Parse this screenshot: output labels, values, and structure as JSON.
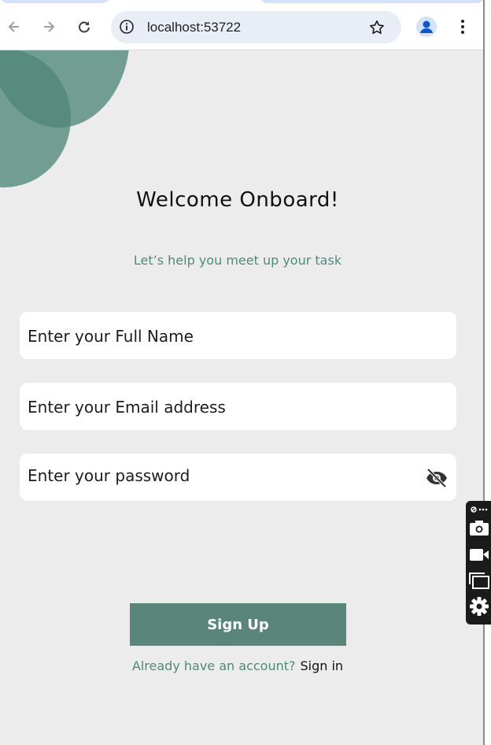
{
  "browser": {
    "back_icon": "arrow-left-icon",
    "forward_icon": "arrow-right-icon",
    "reload_icon": "reload-icon",
    "url": "localhost:53722",
    "info_icon": "info-icon",
    "bookmark_icon": "star-icon",
    "profile_icon": "person-icon",
    "menu_icon": "kebab-icon"
  },
  "page": {
    "title": "Welcome Onboard!",
    "subtitle": "Let’s help you meet up your task",
    "fields": {
      "full_name_placeholder": "Enter your Full Name",
      "email_placeholder": "Enter your Email address",
      "password_placeholder": "Enter your password",
      "password_toggle_icon": "eye-slash-icon"
    },
    "signup_button": "Sign Up",
    "signin_prompt": "Already have an account?",
    "signin_link": "Sign in"
  },
  "extension_toolbar": {
    "icons": [
      "link-icon",
      "more-icon",
      "camera-icon",
      "video-icon",
      "window-icon",
      "gear-icon"
    ]
  },
  "colors": {
    "accent": "#59857a",
    "accent_text": "#4f8a7a",
    "background": "#ececec"
  }
}
